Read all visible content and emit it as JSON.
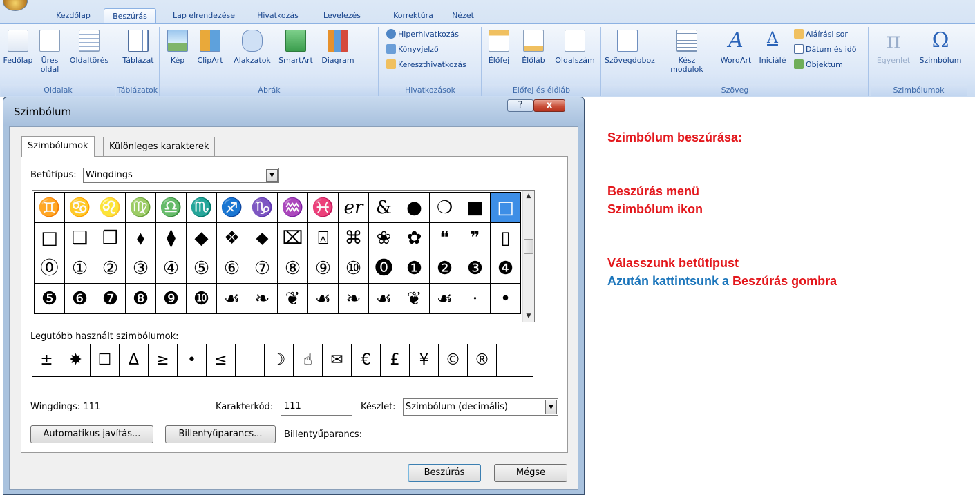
{
  "ribbon": {
    "tabs": [
      "Kezdőlap",
      "Beszúrás",
      "Lap elrendezése",
      "Hivatkozás",
      "Levelezés",
      "Korrektúra",
      "Nézet"
    ],
    "active_tab": "Beszúrás",
    "groups": {
      "oldalak": {
        "label": "Oldalak",
        "fedolap": "Fedőlap",
        "ures": "Üres",
        "ures2": "oldal",
        "oldaltores": "Oldaltörés"
      },
      "tablazatok": {
        "label": "Táblázatok",
        "tablazat": "Táblázat"
      },
      "abrak": {
        "label": "Ábrák",
        "kep": "Kép",
        "clipart": "ClipArt",
        "alakzatok": "Alakzatok",
        "smartart": "SmartArt",
        "diagram": "Diagram"
      },
      "hivatkozasok": {
        "label": "Hivatkozások",
        "hiper": "Hiperhivatkozás",
        "konyvjelzo": "Könyvjelző",
        "kereszt": "Kereszthivatkozás"
      },
      "elofej": {
        "label": "Élőfej és élőláb",
        "elofej": "Élőfej",
        "eloláb": "Élőláb",
        "oldalszam": "Oldalszám"
      },
      "szoveg": {
        "label": "Szöveg",
        "szovegdoboz": "Szövegdoboz",
        "kesz": "Kész",
        "kesz2": "modulok",
        "wordart": "WordArt",
        "inicialé": "Iniciálé",
        "alairasi": "Aláírási sor",
        "datum": "Dátum és idő",
        "objektum": "Objektum"
      },
      "szimbolumok": {
        "label": "Szimbólumok",
        "egyenlet": "Egyenlet",
        "szimbolum": "Szimbólum",
        "pi_glyph": "π",
        "omega_glyph": "Ω"
      }
    }
  },
  "dialog": {
    "title": "Szimbólum",
    "help_glyph": "?",
    "close_glyph": "x",
    "tab_symbols": "Szimbólumok",
    "tab_special": "Különleges karakterek",
    "font_label": "Betűtípus:",
    "font_value": "Wingdings",
    "grid_rows": [
      [
        "♊",
        "♋",
        "♌",
        "♍",
        "♎",
        "♏",
        "♐",
        "♑",
        "♒",
        "♓",
        "𝑒𝑟",
        "&",
        "●",
        "❍",
        "■",
        "□"
      ],
      [
        "□",
        "❑",
        "❒",
        "⬧",
        "⧫",
        "◆",
        "❖",
        "⬥",
        "⌧",
        "⍓",
        "⌘",
        "❀",
        "✿",
        "❝",
        "❞",
        "▯"
      ],
      [
        "⓪",
        "①",
        "②",
        "③",
        "④",
        "⑤",
        "⑥",
        "⑦",
        "⑧",
        "⑨",
        "⑩",
        "⓿",
        "❶",
        "❷",
        "❸",
        "❹"
      ],
      [
        "❺",
        "❻",
        "❼",
        "❽",
        "❾",
        "❿",
        "☙",
        "❧",
        "❦",
        "☙",
        "❧",
        "☙",
        "❦",
        "☙",
        "·",
        "•"
      ]
    ],
    "recent_label": "Legutóbb használt szimbólumok:",
    "recent_symbols": [
      "±",
      "✸",
      "☐",
      "Δ",
      "≥",
      "•",
      "≤",
      " ",
      "☽",
      "☝",
      "✉",
      "€",
      "£",
      "¥",
      "©",
      "®"
    ],
    "char_name": "Wingdings: 111",
    "code_label": "Karakterkód:",
    "code_value": "111",
    "set_label": "Készlet:",
    "set_value": "Szimbólum (decimális)",
    "autocorrect_btn": "Automatikus javítás...",
    "shortcut_btn": "Billentyűparancs...",
    "shortcut_label": "Billentyűparancs:",
    "insert_btn": "Beszúrás",
    "cancel_btn": "Mégse"
  },
  "instructions": {
    "line1": "Szimbólum beszúrása:",
    "line2": "Beszúrás menü",
    "line3": "Szimbólum ikon",
    "line4": "Válasszunk betűtípust",
    "line5a": "Azután kattintsunk a",
    "line5b": "Beszúrás gombra"
  },
  "colors": {
    "accent_red": "#e3161b",
    "accent_blue": "#1b75bb",
    "selected_cell": "#3d8ee6"
  }
}
